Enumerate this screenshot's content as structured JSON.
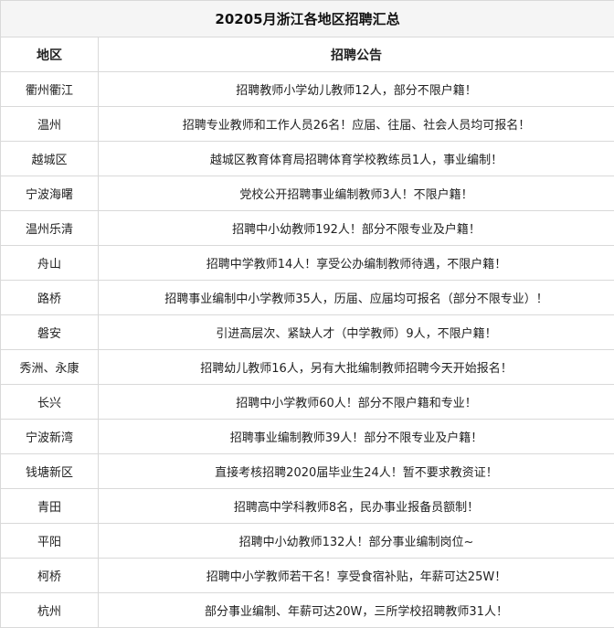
{
  "title": "20205月浙江各地区招聘汇总",
  "headers": {
    "region": "地区",
    "notice": "招聘公告"
  },
  "rows": [
    {
      "region": "衢州衢江",
      "notice": "招聘教师小学幼儿教师12人，部分不限户籍！"
    },
    {
      "region": "温州",
      "notice": "招聘专业教师和工作人员26名！应届、往届、社会人员均可报名！"
    },
    {
      "region": "越城区",
      "notice": "越城区教育体育局招聘体育学校教练员1人，事业编制！"
    },
    {
      "region": "宁波海曙",
      "notice": "党校公开招聘事业编制教师3人！不限户籍！"
    },
    {
      "region": "温州乐清",
      "notice": "招聘中小幼教师192人！部分不限专业及户籍！"
    },
    {
      "region": "舟山",
      "notice": "招聘中学教师14人！享受公办编制教师待遇，不限户籍！"
    },
    {
      "region": "路桥",
      "notice": "招聘事业编制中小学教师35人，历届、应届均可报名（部分不限专业）！"
    },
    {
      "region": "磐安",
      "notice": "引进高层次、紧缺人才（中学教师）9人，不限户籍！"
    },
    {
      "region": "秀洲、永康",
      "notice": "招聘幼儿教师16人，另有大批编制教师招聘今天开始报名！"
    },
    {
      "region": "长兴",
      "notice": "招聘中小学教师60人！部分不限户籍和专业！"
    },
    {
      "region": "宁波新湾",
      "notice": "招聘事业编制教师39人！部分不限专业及户籍！"
    },
    {
      "region": "钱塘新区",
      "notice": "直接考核招聘2020届毕业生24人！暂不要求教资证！"
    },
    {
      "region": "青田",
      "notice": "招聘高中学科教师8名，民办事业报备员额制！"
    },
    {
      "region": "平阳",
      "notice": "招聘中小幼教师132人！部分事业编制岗位~"
    },
    {
      "region": "柯桥",
      "notice": "招聘中小学教师若干名！享受食宿补贴，年薪可达25W！"
    },
    {
      "region": "杭州",
      "notice": "部分事业编制、年薪可达20W，三所学校招聘教师31人！"
    }
  ]
}
